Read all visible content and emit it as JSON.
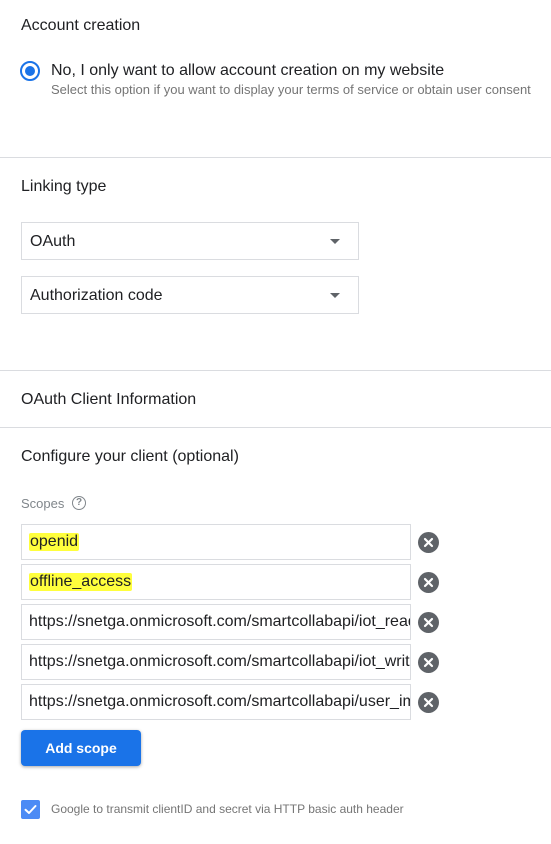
{
  "account_creation": {
    "title": "Account creation",
    "option_label": "No, I only want to allow account creation on my website",
    "option_desc": "Select this option if you want to display your terms of service or obtain user consent"
  },
  "linking_type": {
    "title": "Linking type",
    "type_value": "OAuth",
    "grant_value": "Authorization code"
  },
  "oauth_client": {
    "title": "OAuth Client Information"
  },
  "configure_client": {
    "title": "Configure your client (optional)",
    "scopes_label": "Scopes",
    "help_glyph": "?",
    "scopes": [
      "openid",
      "offline_access",
      "https://snetga.onmicrosoft.com/smartcollabapi/iot_read",
      "https://snetga.onmicrosoft.com/smartcollabapi/iot_write",
      "https://snetga.onmicrosoft.com/smartcollabapi/user_impersonation"
    ],
    "add_scope_label": "Add scope",
    "basic_auth_label": "Google to transmit clientID and secret via HTTP basic auth header",
    "basic_auth_checked": true
  },
  "colors": {
    "accent": "#1a73e8",
    "highlight": "#ffff3d",
    "checkbox": "#4c8bf5"
  },
  "icons": {
    "radio": "radio-selected-icon",
    "dropdown": "dropdown-caret-icon",
    "remove": "remove-circle-icon",
    "help": "help-circle-icon",
    "check": "checkmark-icon"
  }
}
